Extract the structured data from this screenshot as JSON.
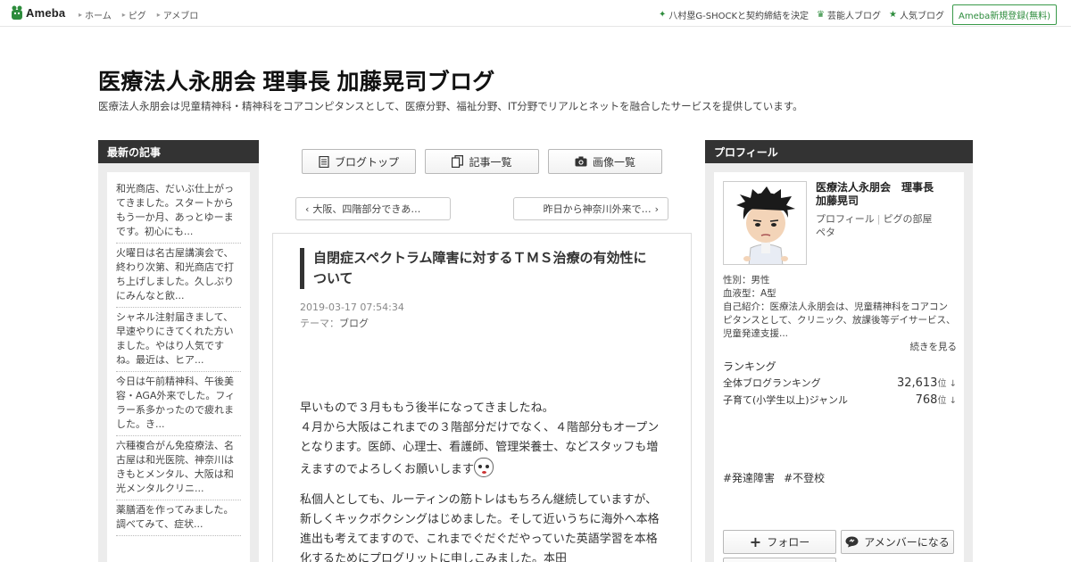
{
  "topbar": {
    "logo": "Ameba",
    "nav": [
      "ホーム",
      "ピグ",
      "アメブロ"
    ],
    "right_links": [
      "八村塁G-SHOCKと契約締結を決定",
      "芸能人ブログ",
      "人気ブログ"
    ],
    "signup": "Ameba新規登録(無料)",
    "accent": "#2d8c3c"
  },
  "header": {
    "title": "医療法人永朋会 理事長 加藤晃司ブログ",
    "description": "医療法人永朋会は児童精神科・精神科をコアコンピタンスとして、医療分野、福祉分野、IT分野でリアルとネットを融合したサービスを提供しています。"
  },
  "left": {
    "heading": "最新の記事",
    "items": [
      "和光商店、だいぶ仕上がってきました。スタートからもう一か月、あっとゆーまです。初心にも...",
      "火曜日は名古屋講演会で、終わり次第、和光商店で打ち上げしました。久しぶりにみんなと飲...",
      "シャネル注射届きまして、早速やりにきてくれた方いました。やはり人気ですね。最近は、ヒア...",
      "今日は午前精神科、午後美容・AGA外来でした。フィラー系多かったので疲れました。き...",
      "六種複合がん免疫療法、名古屋は和光医院、神奈川はきもとメンタル、大阪は和光メンタルクリニ...",
      "薬膳酒を作ってみました。調べてみて、症状..."
    ]
  },
  "center": {
    "buttons": {
      "top": "ブログトップ",
      "list": "記事一覧",
      "images": "画像一覧"
    },
    "prev": "大阪、四階部分できあ…",
    "next": "昨日から神奈川外来で…",
    "article": {
      "title": "自閉症スペクトラム障害に対するＴＭＳ治療の有効性について",
      "date": "2019-03-17 07:54:34",
      "theme_label": "テーマ：",
      "theme": "ブログ",
      "p1": "早いもので３月ももう後半になってきましたね。\n４月から大阪はこれまでの３階部分だけでなく、４階部分もオープンとなります。医師、心理士、看護師、管理栄養士、などスタッフも増えますのでよろしくお願いします",
      "p2": "私個人としても、ルーティンの筋トレはもちろん継続していますが、新しくキックボクシングはじめました。そして近いうちに海外へ本格進出も考えてますので、これまでぐだぐだやっていた英語学習を本格化するためにプログリットに申しこみました。本田"
    }
  },
  "right": {
    "heading": "プロフィール",
    "name": "医療法人永朋会　理事長　加藤晃司",
    "links": [
      "プロフィール",
      "ピグの部屋",
      "ペタ"
    ],
    "gender": "性別：男性",
    "blood": "血液型：A型",
    "intro": "自己紹介：医療法人永朋会は、児童精神科をコアコンピタンスとして、クリニック、放課後等デイサービス、児童発達支援...",
    "more": "続きを見る",
    "ranking_heading": "ランキング",
    "rankings": [
      {
        "label": "全体ブログランキング",
        "value": "32,613",
        "unit": "位 ↓"
      },
      {
        "label": "子育て(小学生以上)ジャンル",
        "value": "768",
        "unit": "位 ↓"
      }
    ],
    "hashtags": [
      "#発達障害",
      "#不登校"
    ],
    "follow": "フォロー",
    "member": "アメンバーになる"
  }
}
